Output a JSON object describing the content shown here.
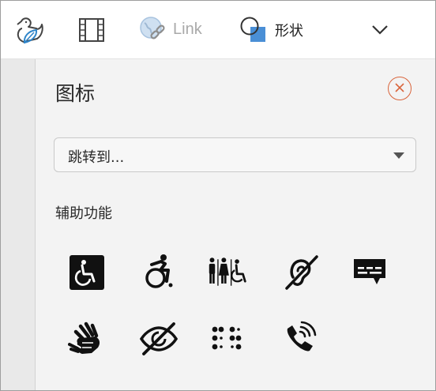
{
  "toolbar": {
    "items": [
      {
        "name": "sticker-icon"
      },
      {
        "name": "video-icon"
      },
      {
        "name": "link-icon",
        "label": "Link"
      },
      {
        "name": "shapes-icon",
        "label": "形状"
      },
      {
        "name": "chevron-down-icon"
      }
    ]
  },
  "pane": {
    "title": "图标",
    "close_icon": "close-circle-icon",
    "jump_dropdown": {
      "value": "跳转到..."
    },
    "section_heading": "辅助功能",
    "icons": [
      "accessible-square-icon",
      "active-wheelchair-icon",
      "accessible-restroom-icon",
      "hearing-impaired-icon",
      "closed-captioning-icon",
      "sign-language-icon",
      "visually-impaired-icon",
      "braille-icon",
      "volume-control-phone-icon"
    ]
  },
  "colors": {
    "accent_close": "#d9643b",
    "icon_fill": "#111111",
    "link_disabled": "#a9a9a9",
    "shape_blue": "#4a8fd6"
  }
}
